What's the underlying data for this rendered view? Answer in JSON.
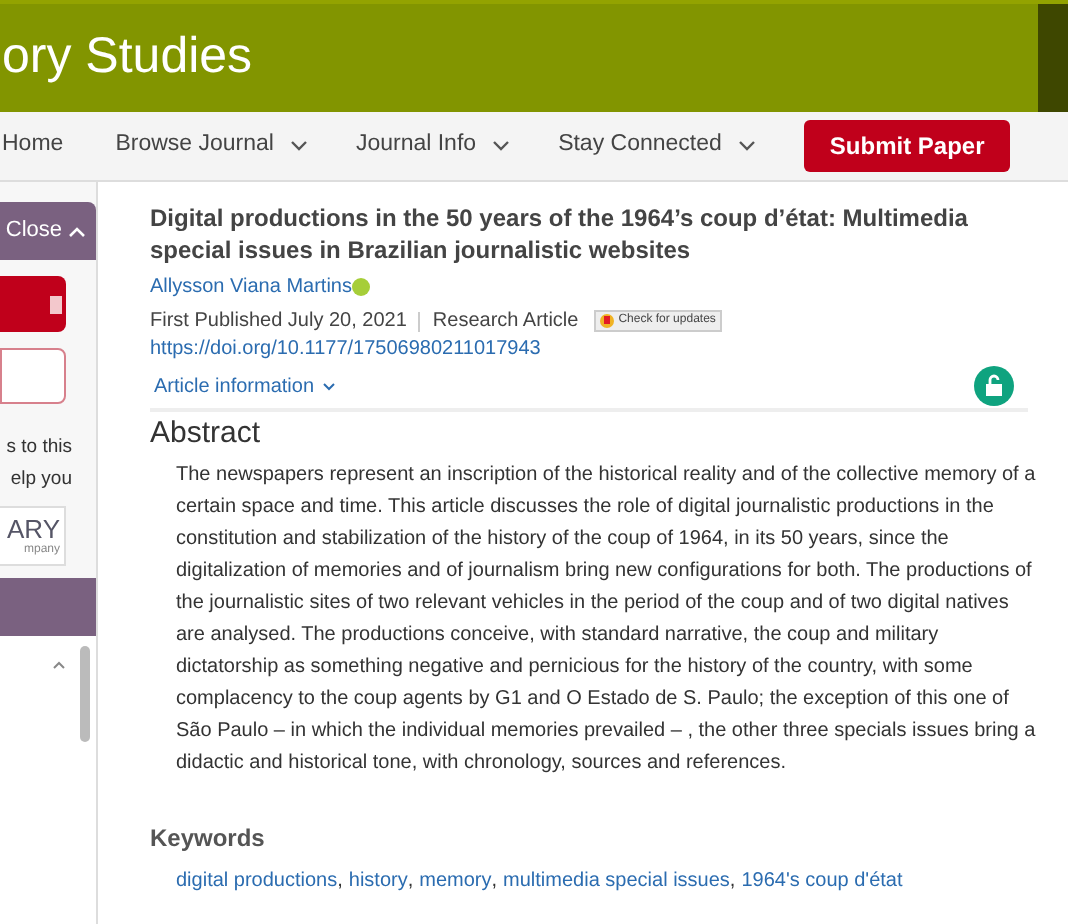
{
  "header": {
    "title": "ory Studies"
  },
  "nav": {
    "items": [
      {
        "label": "Home",
        "dropdown": false
      },
      {
        "label": "Browse Journal",
        "dropdown": true
      },
      {
        "label": "Journal Info",
        "dropdown": true
      },
      {
        "label": "Stay Connected",
        "dropdown": true
      }
    ],
    "button": "Submit Paper"
  },
  "sidebar": {
    "close": "Close",
    "text_lines": [
      "s to this",
      "elp you"
    ],
    "logo": {
      "name": "ARY",
      "tagline": "mpany"
    }
  },
  "article": {
    "title": "Digital productions in the 50 years of the 1964’s coup d’état: Multimedia special issues in Brazilian journalistic websites",
    "author": "Allysson Viana Martins",
    "published": "First Published July 20, 2021",
    "type": "Research Article",
    "check_updates": "Check for updates",
    "doi": "https://doi.org/10.1177/17506980211017943",
    "info_link": "Article information"
  },
  "abstract": {
    "heading": "Abstract",
    "text": "The newspapers represent an inscription of the historical reality and of the collective memory of a certain space and time. This article discusses the role of digital journalistic productions in the constitution and stabilization of the history of the coup of 1964, in its 50 years, since the digitalization of memories and of journalism bring new configurations for both. The productions of the journalistic sites of two relevant vehicles in the period of the coup and of two digital natives are analysed. The productions conceive, with standard narrative, the coup and military dictatorship as something negative and pernicious for the history of the country, with some complacency to the coup agents by G1 and O Estado de S. Paulo; the exception of this one of São Paulo – in which the individual memories prevailed – , the other three specials issues bring a didactic and historical tone, with chronology, sources and references."
  },
  "keywords": {
    "heading": "Keywords",
    "separator": ",",
    "items": [
      "digital productions",
      "history",
      "memory",
      "multimedia special issues",
      "1964's coup d'état"
    ]
  }
}
